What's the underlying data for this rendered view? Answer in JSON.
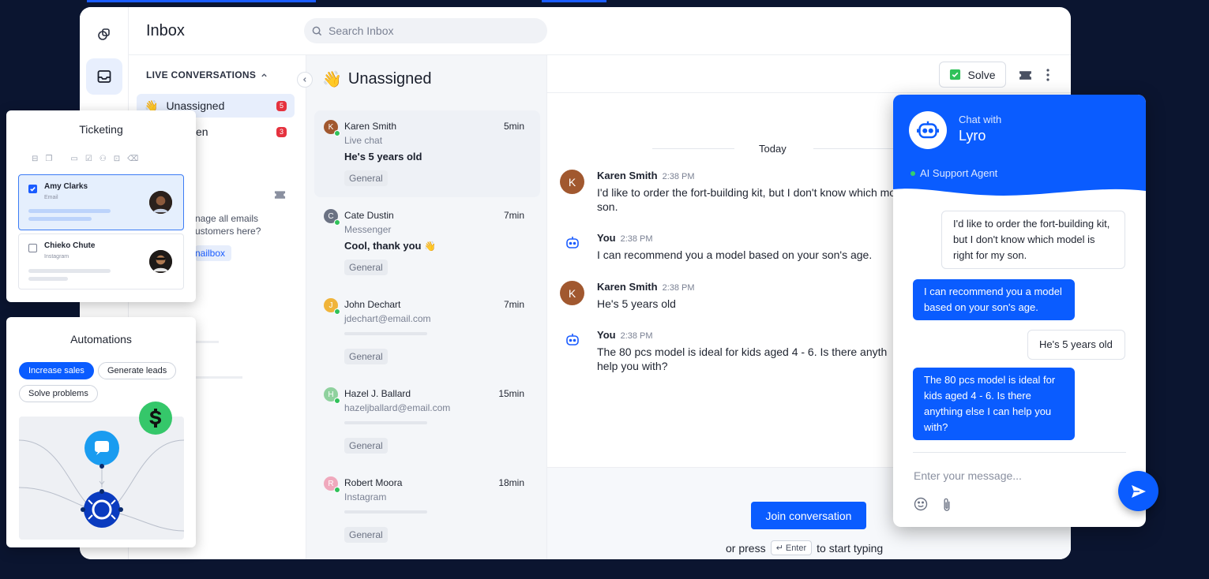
{
  "app": {
    "title": "Inbox"
  },
  "search": {
    "placeholder": "Search Inbox"
  },
  "nav": {
    "section": "LIVE CONVERSATIONS",
    "items": [
      {
        "label": "Unassigned",
        "count": "5"
      },
      {
        "label": "en",
        "count": "3"
      }
    ],
    "hint_line1": "nage all emails",
    "hint_line2": "ustomers here?",
    "mailbox_button": "nailbox"
  },
  "list": {
    "title": "Unassigned",
    "conversations": [
      {
        "initial": "K",
        "name": "Karen Smith",
        "time": "5min",
        "channel": "Live chat",
        "message": "He's 5 years old",
        "tag": "General",
        "color": "#a1582f"
      },
      {
        "initial": "C",
        "name": "Cate Dustin",
        "time": "7min",
        "channel": "Messenger",
        "message": "Cool, thank you",
        "tag": "General",
        "color": "#6b7283"
      },
      {
        "initial": "J",
        "name": "John Dechart",
        "time": "7min",
        "channel": "jdechart@email.com",
        "tag": "General",
        "color": "#f0b43a"
      },
      {
        "initial": "H",
        "name": "Hazel J. Ballard",
        "time": "15min",
        "channel": "hazeljballard@email.com",
        "tag": "General",
        "color": "#8fd19e"
      },
      {
        "initial": "R",
        "name": "Robert Moora",
        "time": "18min",
        "channel": "Instagram",
        "tag": "General",
        "color": "#f0a9bd"
      }
    ]
  },
  "chat": {
    "solve_label": "Solve",
    "day_label": "Today",
    "messages": [
      {
        "author": "Karen Smith",
        "time": "2:38 PM",
        "text": "I'd like to order the fort-building kit, but I don't know which mo son."
      },
      {
        "author": "You",
        "time": "2:38 PM",
        "text": "I can recommend you a model based on your son's age."
      },
      {
        "author": "Karen Smith",
        "time": "2:38 PM",
        "text": "He's 5 years old"
      },
      {
        "author": "You",
        "time": "2:38 PM",
        "text": "The 80 pcs model is ideal for kids aged 4 - 6. Is there anyth help you with?"
      }
    ],
    "join_label": "Join conversation",
    "press_prefix": "or press",
    "press_key": "↵ Enter",
    "press_suffix": "to start typing"
  },
  "ticketing": {
    "title": "Ticketing",
    "cards": [
      {
        "name": "Amy Clarks",
        "source": "Email",
        "checked": true
      },
      {
        "name": "Chieko Chute",
        "source": "Instagram",
        "checked": false
      }
    ]
  },
  "automations": {
    "title": "Automations",
    "chips": [
      "Increase sales",
      "Generate leads",
      "Solve problems"
    ]
  },
  "lyro": {
    "chat_with": "Chat with",
    "name": "Lyro",
    "status": "AI Support Agent",
    "messages": [
      {
        "from": "user",
        "text": "I'd like to order the fort-building kit, but I don't know which model is right for my son."
      },
      {
        "from": "bot",
        "text": "I can recommend you a model based on your son's age."
      },
      {
        "from": "user",
        "text": "He's 5 years old"
      },
      {
        "from": "bot",
        "text": "The 80 pcs model is ideal for kids aged 4 - 6. Is there anything else I can help you with?"
      }
    ],
    "input_placeholder": "Enter your message..."
  },
  "colors": {
    "brand": "#0a5cff",
    "background": "#0b1530",
    "badge": "#e5323e",
    "online": "#30c15a"
  }
}
